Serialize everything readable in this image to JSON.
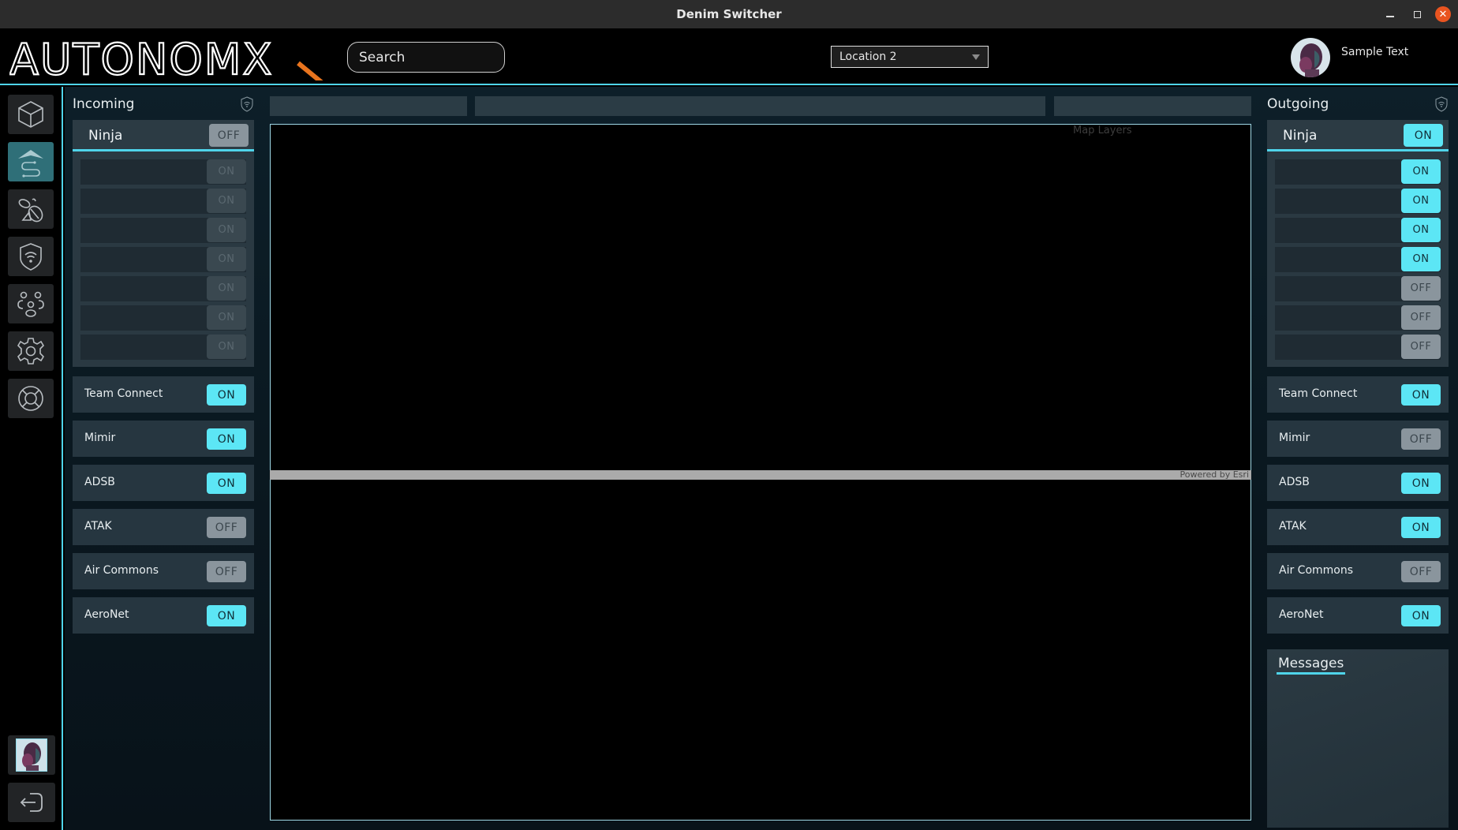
{
  "window": {
    "title": "Denim Switcher",
    "controls": {
      "minimize": "minimize",
      "maximize": "restore",
      "close": "✕"
    }
  },
  "header": {
    "logo_text": "AUTONOMX",
    "search": {
      "placeholder": "Search",
      "value": ""
    },
    "location": {
      "selected": "Location 2"
    },
    "user": {
      "name": "Sample Text"
    }
  },
  "colors": {
    "accent": "#4fd4ea",
    "toggle_on": "#5ce6f5",
    "toggle_off": "#8a959d",
    "logo_accent": "#e8741e",
    "nav_active": "#2f6f78"
  },
  "nav": {
    "items": [
      {
        "icon": "cube-icon",
        "active": false
      },
      {
        "icon": "aircraft-route-icon",
        "active": true
      },
      {
        "icon": "bee-icon",
        "active": false
      },
      {
        "icon": "shield-wifi-icon",
        "active": false
      },
      {
        "icon": "team-icon",
        "active": false
      },
      {
        "icon": "gear-icon",
        "active": false
      },
      {
        "icon": "lifebuoy-icon",
        "active": false
      }
    ],
    "bottom": [
      {
        "icon": "user-avatar"
      },
      {
        "icon": "logout-icon"
      }
    ]
  },
  "incoming": {
    "title": "Incoming",
    "ninja": {
      "label": "Ninja",
      "state": "OFF",
      "sub_toggles": [
        "ON",
        "ON",
        "ON",
        "ON",
        "ON",
        "ON",
        "ON"
      ]
    },
    "services": [
      {
        "label": "Team Connect",
        "state": "ON"
      },
      {
        "label": "Mimir",
        "state": "ON"
      },
      {
        "label": "ADSB",
        "state": "ON"
      },
      {
        "label": "ATAK",
        "state": "OFF"
      },
      {
        "label": "Air Commons",
        "state": "OFF"
      },
      {
        "label": "AeroNet",
        "state": "ON"
      }
    ]
  },
  "outgoing": {
    "title": "Outgoing",
    "ninja": {
      "label": "Ninja",
      "state": "ON",
      "sub_toggles": [
        "ON",
        "ON",
        "ON",
        "ON",
        "OFF",
        "OFF",
        "OFF"
      ]
    },
    "services": [
      {
        "label": "Team Connect",
        "state": "ON"
      },
      {
        "label": "Mimir",
        "state": "OFF"
      },
      {
        "label": "ADSB",
        "state": "ON"
      },
      {
        "label": "ATAK",
        "state": "ON"
      },
      {
        "label": "Air Commons",
        "state": "OFF"
      },
      {
        "label": "AeroNet",
        "state": "ON"
      }
    ]
  },
  "map": {
    "layers_label": "Map Layers",
    "attribution": "Powered by Esri"
  },
  "messages": {
    "title": "Messages"
  }
}
